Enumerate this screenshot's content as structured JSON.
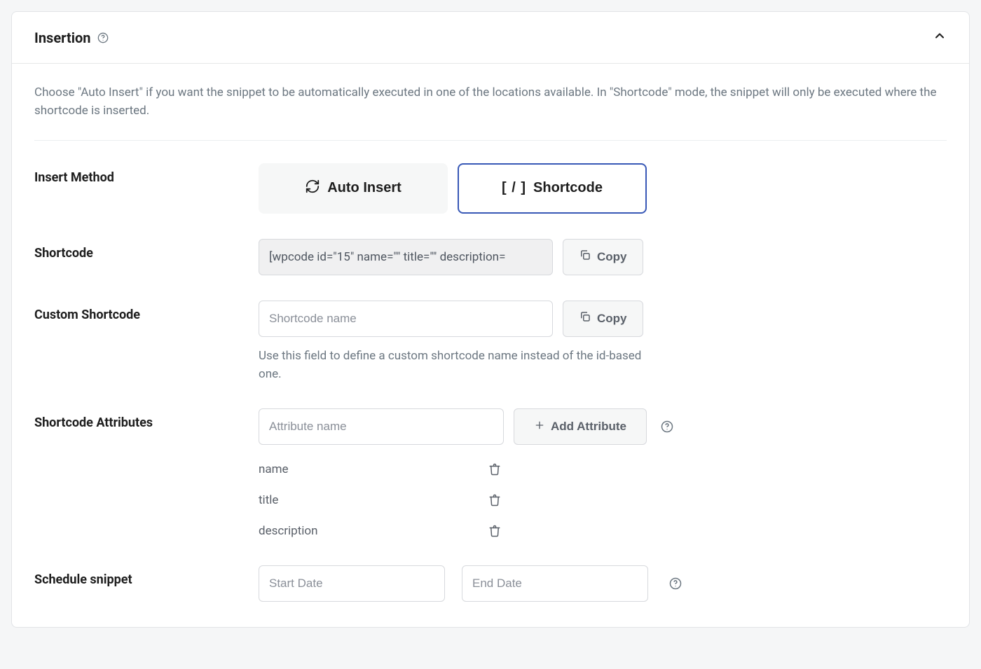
{
  "panel": {
    "title": "Insertion",
    "collapsed": false,
    "intro": "Choose \"Auto Insert\" if you want the snippet to be automatically executed in one of the locations available. In \"Shortcode\" mode, the snippet will only be executed where the shortcode is inserted."
  },
  "insert_method": {
    "label": "Insert Method",
    "options": {
      "auto": "Auto Insert",
      "shortcode": "Shortcode"
    },
    "selected": "shortcode"
  },
  "shortcode": {
    "label": "Shortcode",
    "value": "[wpcode id=\"15\" name=\"\" title=\"\" description=",
    "copy_label": "Copy"
  },
  "custom_shortcode": {
    "label": "Custom Shortcode",
    "placeholder": "Shortcode name",
    "value": "",
    "copy_label": "Copy",
    "help": "Use this field to define a custom shortcode name instead of the id-based one."
  },
  "shortcode_attributes": {
    "label": "Shortcode Attributes",
    "input_placeholder": "Attribute name",
    "add_label": "Add Attribute",
    "items": [
      "name",
      "title",
      "description"
    ]
  },
  "schedule": {
    "label": "Schedule snippet",
    "start_placeholder": "Start Date",
    "end_placeholder": "End Date",
    "start_value": "",
    "end_value": ""
  }
}
